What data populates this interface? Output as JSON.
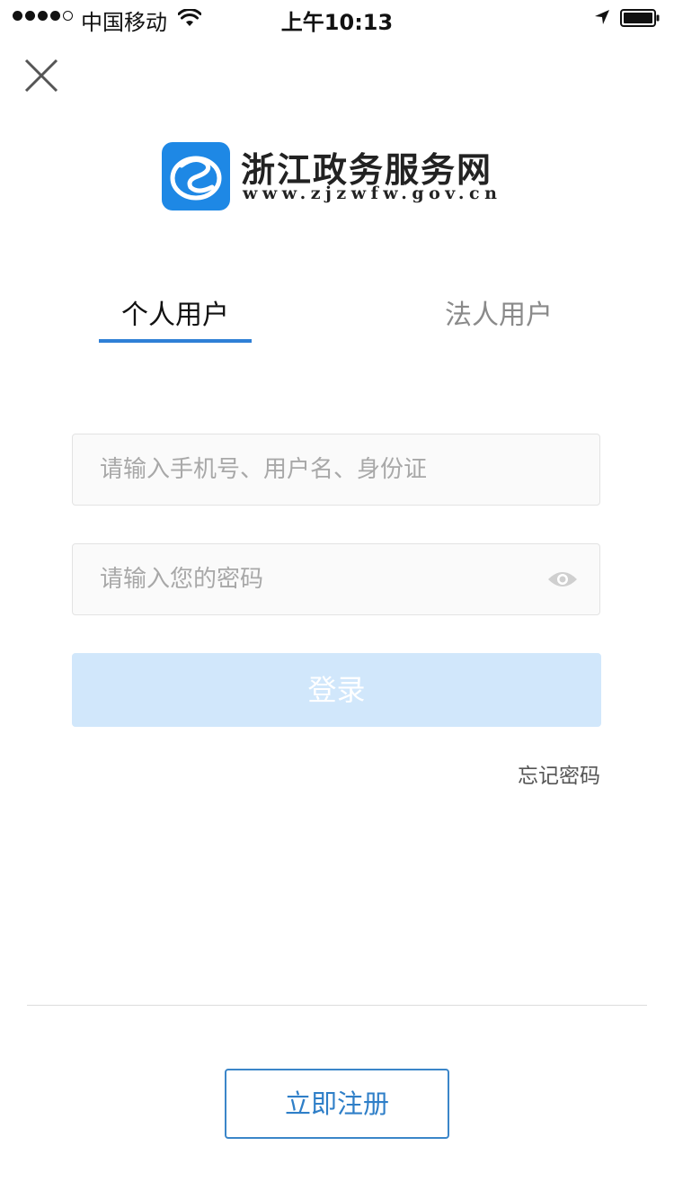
{
  "status_bar": {
    "carrier": "中国移动",
    "time": "上午10:13",
    "signal_bars": 4,
    "signal_total": 5
  },
  "close": {
    "icon": "close-icon"
  },
  "brand": {
    "title": "浙江政务服务网",
    "url": "www.zjzwfw.gov.cn",
    "logo_color": "#1e88e5"
  },
  "tabs": [
    {
      "label": "个人用户",
      "active": true
    },
    {
      "label": "法人用户",
      "active": false
    }
  ],
  "form": {
    "username_placeholder": "请输入手机号、用户名、身份证",
    "password_placeholder": "请输入您的密码",
    "password_toggle_icon": "eye-icon",
    "login_label": "登录",
    "forgot_label": "忘记密码"
  },
  "footer": {
    "register_label": "立即注册"
  },
  "colors": {
    "accent": "#2f80d6",
    "login_disabled_bg": "#d1e7fb"
  }
}
